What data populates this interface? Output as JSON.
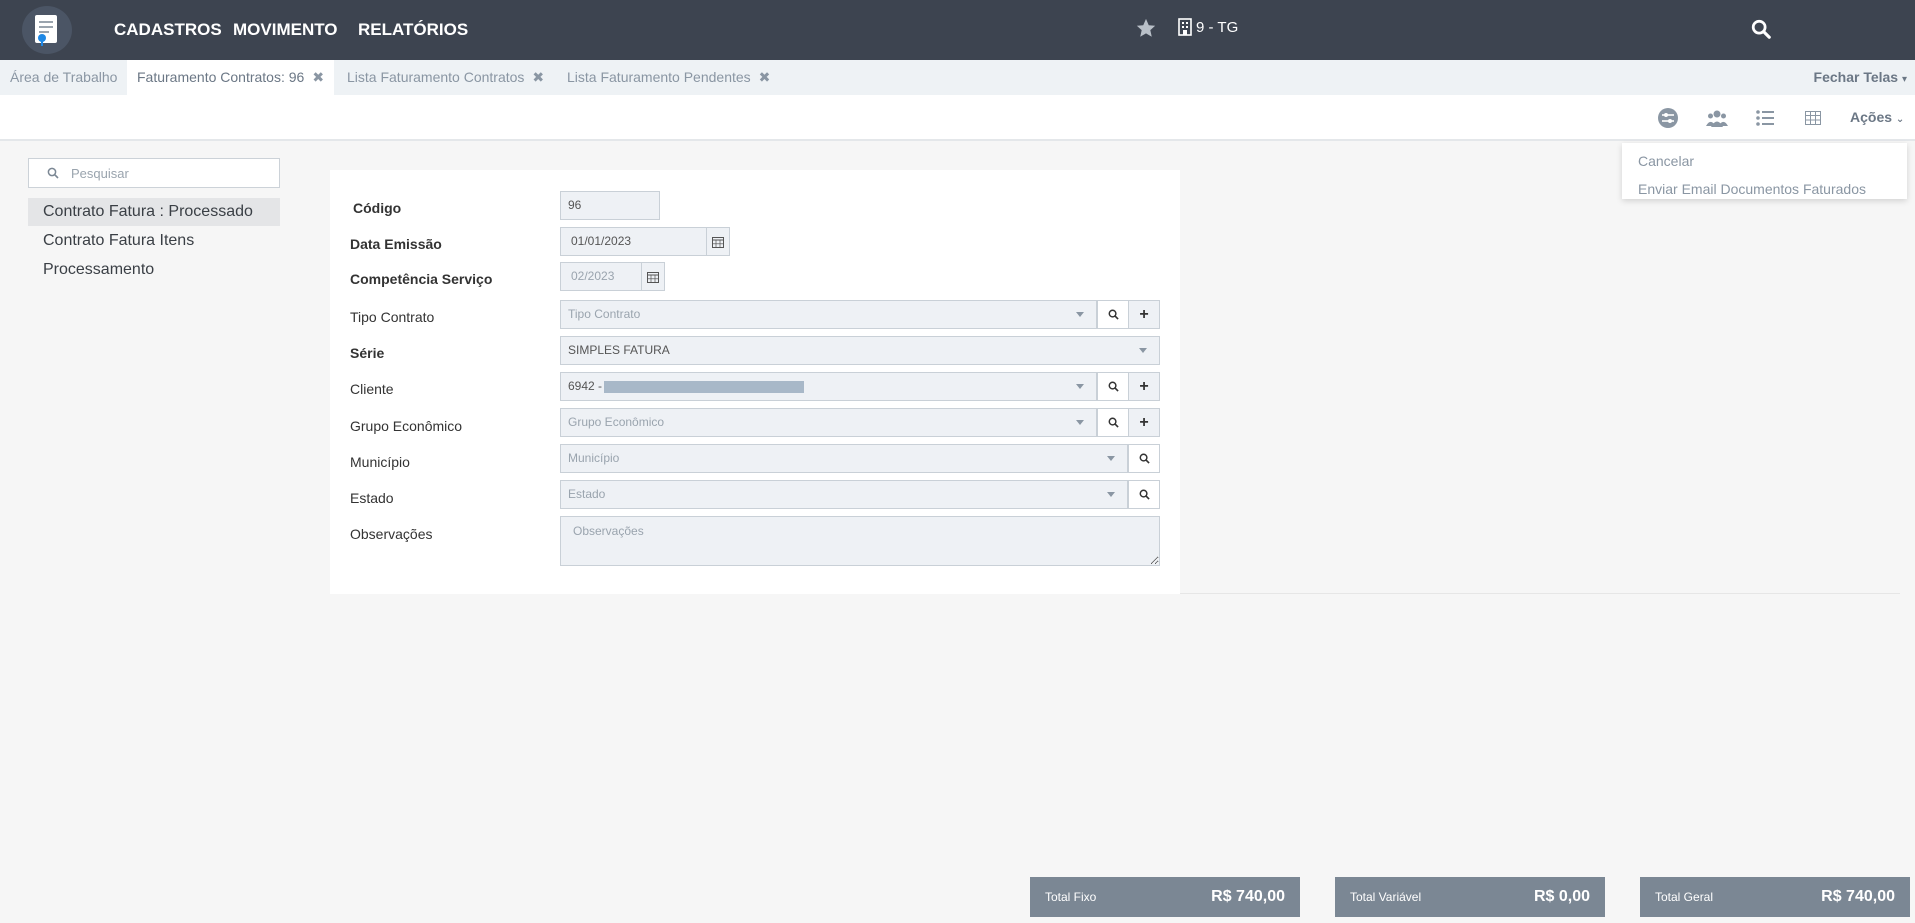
{
  "nav": {
    "items": [
      "CADASTROS",
      "MOVIMENTO",
      "RELATÓRIOS"
    ],
    "company": "9 - TG"
  },
  "tabs": [
    {
      "label": "Área de Trabalho",
      "closable": false
    },
    {
      "label": "Faturamento Contratos: 96",
      "closable": true
    },
    {
      "label": "Lista Faturamento Contratos",
      "closable": true
    },
    {
      "label": "Lista Faturamento Pendentes",
      "closable": true
    }
  ],
  "tab_close_glyph": "✖",
  "close_screens": "Fechar Telas",
  "toolbar": {
    "actions_label": "Ações",
    "icons": [
      "sliders-icon",
      "users-icon",
      "list-icon",
      "table-icon"
    ]
  },
  "actions_menu": [
    "Cancelar",
    "Enviar Email Documentos Faturados"
  ],
  "sidebar": {
    "search_placeholder": "Pesquisar",
    "items": [
      "Contrato Fatura : Processado",
      "Contrato Fatura Itens",
      "Processamento"
    ]
  },
  "form": {
    "codigo": {
      "label": "Código",
      "value": "96"
    },
    "data_emissao": {
      "label": "Data Emissão",
      "value": "01/01/2023"
    },
    "competencia": {
      "label": "Competência Serviço",
      "value": "02/2023"
    },
    "tipo_contrato": {
      "label": "Tipo Contrato",
      "placeholder": "Tipo Contrato"
    },
    "serie": {
      "label": "Série",
      "value": "SIMPLES FATURA"
    },
    "cliente": {
      "label": "Cliente",
      "value": "6942 -"
    },
    "grupo": {
      "label": "Grupo Econômico",
      "placeholder": "Grupo Econômico"
    },
    "municipio": {
      "label": "Município",
      "placeholder": "Município"
    },
    "estado": {
      "label": "Estado",
      "placeholder": "Estado"
    },
    "observacoes": {
      "label": "Observações",
      "placeholder": "Observações"
    }
  },
  "totals": [
    {
      "label": "Total Fixo",
      "value": "R$ 740,00"
    },
    {
      "label": "Total Variável",
      "value": "R$ 0,00"
    },
    {
      "label": "Total Geral",
      "value": "R$ 740,00"
    }
  ],
  "colors": {
    "topbar": "#3d4450",
    "total_box": "#7b8794",
    "input_bg": "#eef1f5"
  }
}
